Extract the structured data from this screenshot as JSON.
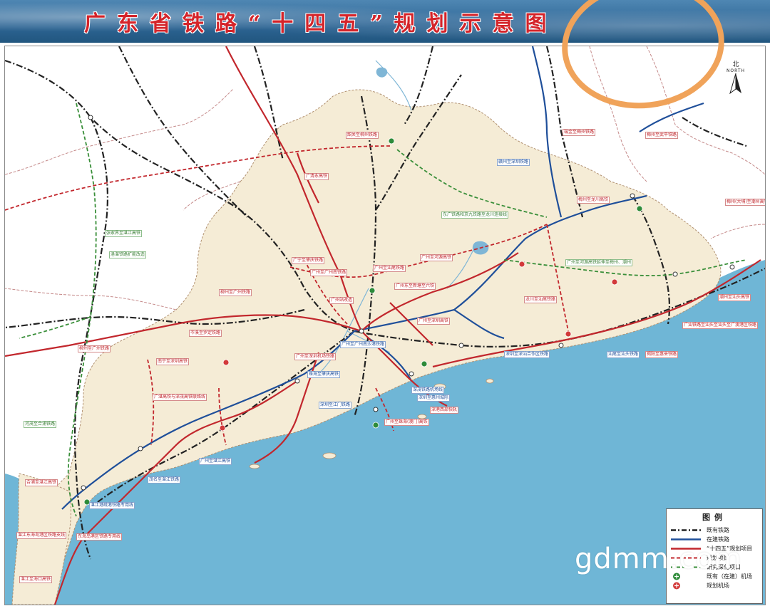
{
  "title": "广东省铁路“十四五”规划示意图",
  "north": {
    "glyph": "北",
    "text": "NORTH"
  },
  "watermark": "gdmm.com",
  "colors": {
    "land": "#f5ecd6",
    "sea": "#6fb6d6",
    "existing": "#222222",
    "under_construction": "#1f4f9a",
    "planned": "#c2272d",
    "research": "#3a8f3a"
  },
  "legend": {
    "title": "图例",
    "items": [
      {
        "key": "existing",
        "text": "既有铁路"
      },
      {
        "key": "construction",
        "text": "在建铁路"
      },
      {
        "key": "planned",
        "text": "“十四五”规划项目"
      },
      {
        "key": "planned_dashed",
        "text": "规划项目"
      },
      {
        "key": "research",
        "text": "研究深化项目"
      },
      {
        "key": "airport_existing",
        "text": "既有（在建）机场"
      },
      {
        "key": "airport_planned",
        "text": "规划机场"
      }
    ]
  },
  "labels": {
    "l1": "韶关至柳州铁路",
    "l2": "广清永高铁",
    "l3": "赣州至深圳铁路",
    "l4": "瑞金至梅州铁路",
    "l5": "梅州至武平铁路",
    "l6": "梅州至龙川高铁",
    "l7": "梅州(大埔)至潮州高铁",
    "l8": "东广铁路和京九铁路至龙川连接线",
    "l9": "广州至河源高铁",
    "l10": "广州至汕尾铁路",
    "l11": "广州东至新塘至六铁",
    "l12": "广州至深圳高铁",
    "l13": "龙川至汕尾铁路",
    "l14": "广州至河源高铁延伸至梅州、潮州",
    "l15": "潮州至汕头高铁",
    "l16": "广汕铁路至汕头至汕头至广澳港区铁路",
    "l17": "深圳至深汕合作区铁路",
    "l18": "汕尾至汕头铁路",
    "l19": "揭阳至惠来铁路",
    "l20": "柳州至广州铁路",
    "l21": "广宁至肇庆铁路",
    "l22": "广州至广州南铁路",
    "l23": "广州站改造",
    "l24": "岑溪至罗定铁路",
    "l25": "广州至广州南沙港铁路",
    "l26": "广州至深圳机场铁路",
    "l27": "南宁至深圳高铁",
    "l28": "广湛高铁与深茂高铁联络线",
    "l29": "珠海至肇庆高铁",
    "l30": "深圳至江门铁路",
    "l31": "广州至珠海(澳门)高铁",
    "l32": "深茂铁路机场线",
    "l33": "深圳至惠州城际",
    "l34": "深港西部快轨",
    "l35": "广州至湛江高铁",
    "l36": "茂名至湛江铁路",
    "l37": "合浦至湛江高铁",
    "l38": "湛江港疏港铁路专用线",
    "l39": "东海岛港区铁路专用线",
    "l40": "湛江东海岛港区铁路支线",
    "l41": "湛江至海口高铁",
    "l42": "张家界至湛江高铁",
    "l43": "柳州至广州铁路",
    "l44": "河茂至合浦铁路",
    "l45": "洛湛铁路扩能改造"
  }
}
